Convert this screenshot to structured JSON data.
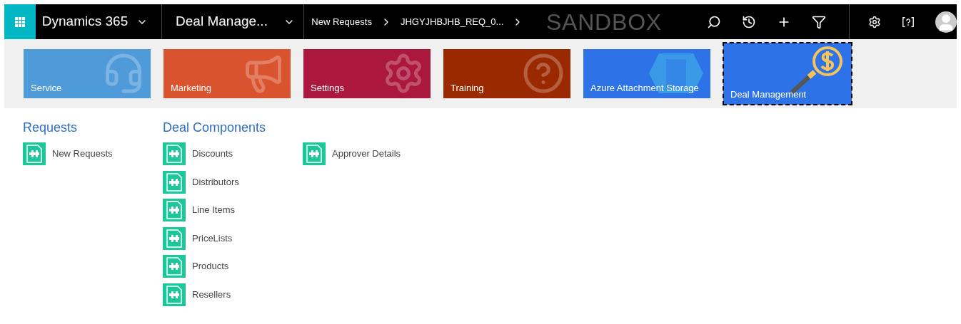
{
  "nav_bar": {
    "app_name": "Dynamics 365",
    "module": "Deal Manage...",
    "breadcrumbs": [
      "New Requests",
      "JHGYJHBJHB_REQ_0..."
    ],
    "environment": "SANDBOX"
  },
  "tiles": [
    {
      "label": "Service",
      "kind": "service",
      "color": "#4f9bd9",
      "selected": false
    },
    {
      "label": "Marketing",
      "kind": "marketing",
      "color": "#d9532f",
      "selected": false
    },
    {
      "label": "Settings",
      "kind": "settings",
      "color": "#ab173d",
      "selected": false
    },
    {
      "label": "Training",
      "kind": "training",
      "color": "#9a2900",
      "selected": false
    },
    {
      "label": "Azure Attachment Storage",
      "kind": "storage",
      "color": "#2d72e6",
      "selected": false
    },
    {
      "label": "Deal Management",
      "kind": "deal",
      "color": "#2d72e6",
      "selected": true
    }
  ],
  "groups": [
    {
      "title": "Requests",
      "items": [
        "New Requests"
      ]
    },
    {
      "title": "Deal Components",
      "items": [
        "Discounts",
        "Distributors",
        "Line Items",
        "PriceLists",
        "Products",
        "Resellers"
      ]
    },
    {
      "items": [
        "Approver Details"
      ]
    }
  ]
}
